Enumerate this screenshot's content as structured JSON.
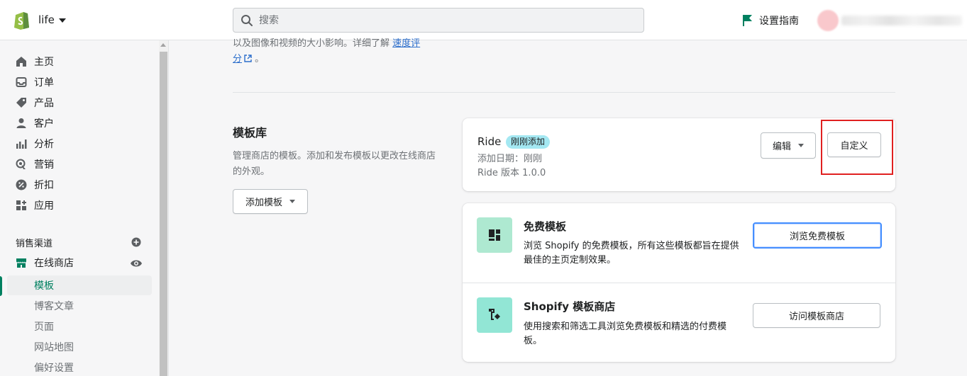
{
  "topbar": {
    "store_name": "life",
    "search_placeholder": "搜索",
    "setup_guide": "设置指南",
    "user_name": "███████"
  },
  "sidebar": {
    "items": [
      {
        "label": "主页",
        "icon": "home-icon"
      },
      {
        "label": "订单",
        "icon": "orders-icon"
      },
      {
        "label": "产品",
        "icon": "tag-icon"
      },
      {
        "label": "客户",
        "icon": "person-icon"
      },
      {
        "label": "分析",
        "icon": "bar-chart-icon"
      },
      {
        "label": "营销",
        "icon": "marketing-icon"
      },
      {
        "label": "折扣",
        "icon": "discount-icon"
      },
      {
        "label": "应用",
        "icon": "apps-icon"
      }
    ],
    "sales_channels_title": "销售渠道",
    "online_store": "在线商店",
    "sub_items": [
      {
        "label": "模板",
        "active": true
      },
      {
        "label": "博客文章",
        "active": false
      },
      {
        "label": "页面",
        "active": false
      },
      {
        "label": "网站地图",
        "active": false
      },
      {
        "label": "偏好设置",
        "active": false
      }
    ]
  },
  "main": {
    "intro_line1": "以及图像和视频的大小影响。详细了解",
    "intro_link1": "速度评",
    "intro_link2": "分",
    "intro_end": "。",
    "library": {
      "title": "模板库",
      "description": "管理商店的模板。添加和发布模板以更改在线商店的外观。",
      "add_button": "添加模板"
    },
    "current_theme": {
      "name": "Ride",
      "badge": "刚刚添加",
      "date": "添加日期：刚刚",
      "version": "Ride 版本 1.0.0",
      "edit_button": "编辑",
      "customize_button": "自定义"
    },
    "free_themes": {
      "title": "免费模板",
      "description": "浏览 Shopify 的免费模板，所有这些模板都旨在提供最佳的主页定制效果。",
      "button": "浏览免费模板"
    },
    "theme_store": {
      "title": "Shopify 模板商店",
      "description": "使用搜索和筛选工具浏览免费模板和精选的付费模板。",
      "button": "访问模板商店"
    }
  },
  "colors": {
    "accent_green": "#008060",
    "badge_blue": "#a4e8f2",
    "highlight_red": "#e02020",
    "link_blue": "#2c6ecb"
  }
}
